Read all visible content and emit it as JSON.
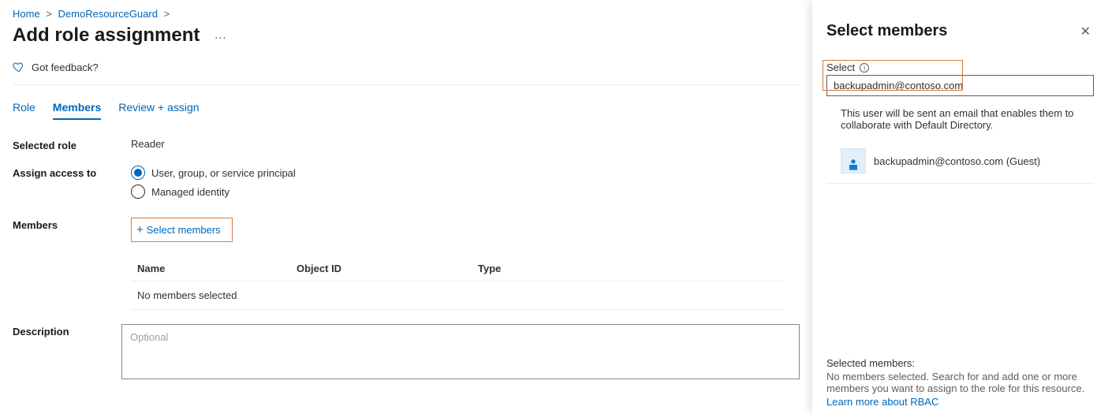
{
  "breadcrumb": {
    "home": "Home",
    "resource": "DemoResourceGuard"
  },
  "page_title": "Add role assignment",
  "feedback_label": "Got feedback?",
  "tabs": {
    "role": "Role",
    "members": "Members",
    "review": "Review + assign"
  },
  "labels": {
    "selected_role": "Selected role",
    "assign_access": "Assign access to",
    "members": "Members",
    "description": "Description"
  },
  "values": {
    "selected_role": "Reader",
    "assign_option_user": "User, group, or service principal",
    "assign_option_mi": "Managed identity",
    "select_members_btn": "Select members",
    "no_members": "No members selected",
    "desc_placeholder": "Optional"
  },
  "table": {
    "col_name": "Name",
    "col_obj": "Object ID",
    "col_type": "Type"
  },
  "panel": {
    "title": "Select members",
    "select_label": "Select",
    "input_value": "backupadmin@contoso.com",
    "hint": "This user will be sent an email that enables them to collaborate with Default Directory.",
    "result": "backupadmin@contoso.com (Guest)",
    "footer_header": "Selected members:",
    "footer_body": "No members selected. Search for and add one or more members you want to assign to the role for this resource.",
    "learn_more": "Learn more about RBAC"
  }
}
